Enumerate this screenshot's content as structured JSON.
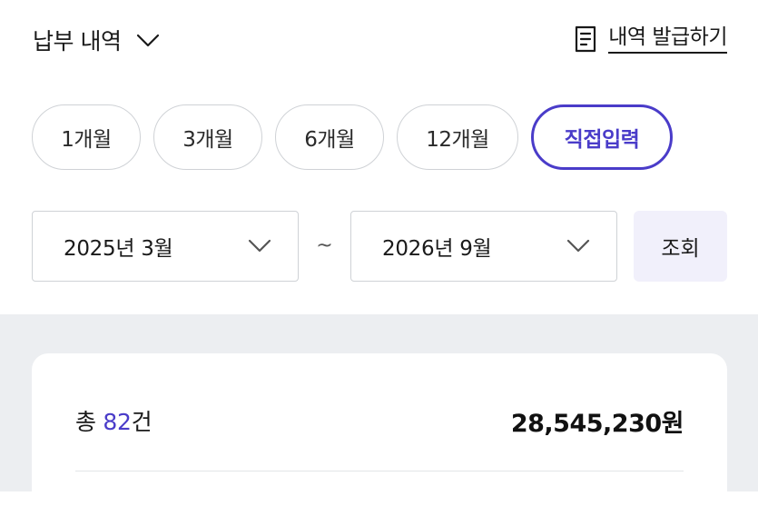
{
  "header": {
    "title": "납부 내역",
    "issue_link_label": "내역 발급하기"
  },
  "period_filters": [
    {
      "label": "1개월",
      "selected": false
    },
    {
      "label": "3개월",
      "selected": false
    },
    {
      "label": "6개월",
      "selected": false
    },
    {
      "label": "12개월",
      "selected": false
    },
    {
      "label": "직접입력",
      "selected": true
    }
  ],
  "date_range": {
    "start": "2025년 3월",
    "separator": "~",
    "end": "2026년 9월",
    "search_label": "조회"
  },
  "summary": {
    "prefix": "총 ",
    "count": "82",
    "suffix": "건",
    "total_amount": "28,545,230원"
  },
  "colors": {
    "accent": "#4a3cc9",
    "chip_border": "#cfd2d6",
    "section_bg": "#eceef1",
    "search_bg": "#f1f0fb"
  }
}
